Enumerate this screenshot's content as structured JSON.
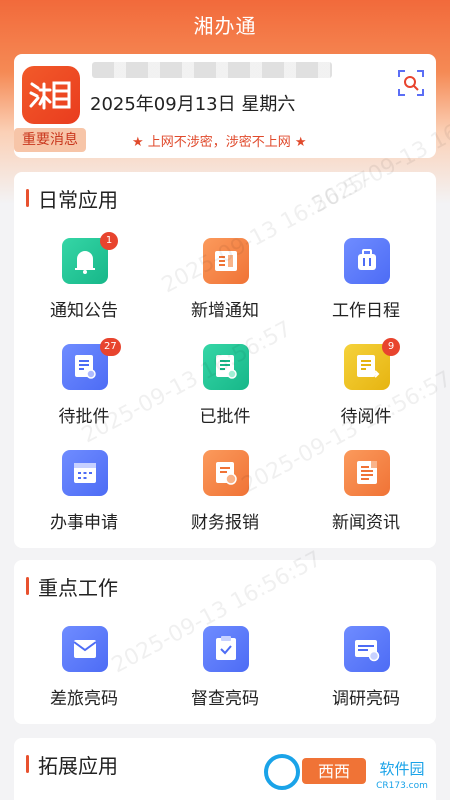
{
  "header": {
    "title": "湘办通"
  },
  "user": {
    "logo_text": "湘",
    "date": "2025年09月13日 星期六"
  },
  "notice": {
    "tag": "重要消息",
    "text": "★ 上网不涉密，涉密不上网 ★"
  },
  "daily": {
    "title": "日常应用",
    "items": [
      {
        "label": "通知公告",
        "icon": "bell-icon",
        "badge": "1"
      },
      {
        "label": "新增通知",
        "icon": "document-icon",
        "badge": ""
      },
      {
        "label": "工作日程",
        "icon": "briefcase-icon",
        "badge": ""
      },
      {
        "label": "待批件",
        "icon": "pending-approval-icon",
        "badge": "27"
      },
      {
        "label": "已批件",
        "icon": "approved-doc-icon",
        "badge": ""
      },
      {
        "label": "待阅件",
        "icon": "to-read-doc-icon",
        "badge": "9"
      },
      {
        "label": "办事申请",
        "icon": "calendar-icon",
        "badge": ""
      },
      {
        "label": "财务报销",
        "icon": "finance-icon",
        "badge": ""
      },
      {
        "label": "新闻资讯",
        "icon": "news-icon",
        "badge": ""
      }
    ]
  },
  "key_work": {
    "title": "重点工作",
    "items": [
      {
        "label": "差旅亮码",
        "icon": "envelope-icon"
      },
      {
        "label": "督查亮码",
        "icon": "clipboard-check-icon"
      },
      {
        "label": "调研亮码",
        "icon": "card-check-icon"
      }
    ]
  },
  "extended": {
    "title": "拓展应用"
  },
  "watermark": {
    "text": "2025-09-13 16:56:57"
  },
  "site_logo": {
    "name": "西西软件园",
    "url_text": "CR173.com"
  }
}
